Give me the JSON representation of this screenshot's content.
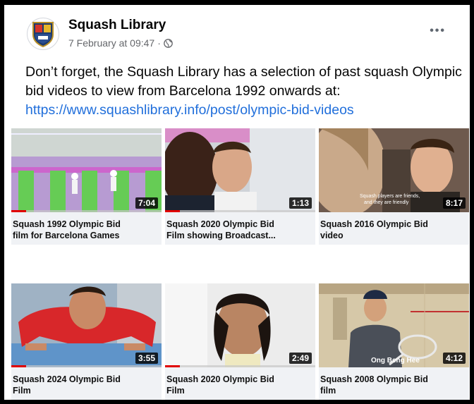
{
  "post": {
    "author": "Squash Library",
    "timestamp": "7 February at 09:47",
    "separator": "·",
    "audience_icon": "globe-icon",
    "more_icon": "more-options-icon",
    "more_glyph": "•••",
    "text_line1": "Don’t forget, the Squash Library has a selection of past squash Olympic",
    "text_line2": "bid videos to view from Barcelona 1992 onwards  at:",
    "link": "https://www.squashlibrary.info/post/olympic-bid-videos"
  },
  "videos": [
    {
      "title_line1": "Squash 1992 Olympic Bid",
      "title_line2": "film for Barcelona Games",
      "duration": "7:04",
      "progress": 0.1
    },
    {
      "title_line1": "Squash 2020 Olympic Bid",
      "title_line2": "Film showing Broadcast...",
      "duration": "1:13",
      "progress": 0.1
    },
    {
      "title_line1": "Squash 2016 Olympic Bid",
      "title_line2": "video",
      "duration": "8:17",
      "progress": 0
    },
    {
      "title_line1": "Squash 2024 Olympic Bid",
      "title_line2": "Film",
      "duration": "3:55",
      "progress": 0.1
    },
    {
      "title_line1": "Squash 2020 Olympic Bid",
      "title_line2": "Film",
      "duration": "2:49",
      "progress": 0.1
    },
    {
      "title_line1": "Squash 2008 Olympic Bid",
      "title_line2": "film",
      "duration": "4:12",
      "progress": 0
    }
  ],
  "thumb_text": {
    "v3_subtitle_line1": "Squash players are friends,",
    "v3_subtitle_line2": "and they are friendly",
    "v6_name": "Ong Beng Hee"
  },
  "colors": {
    "link": "#216fdb",
    "text": "#050505",
    "meta": "#65676b",
    "progress": "#e00000"
  }
}
